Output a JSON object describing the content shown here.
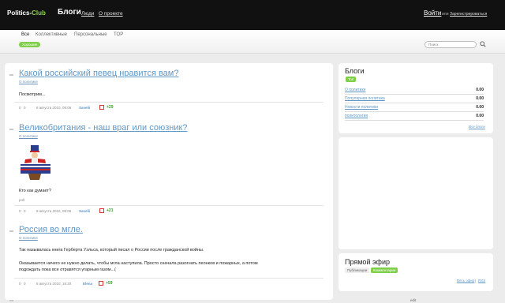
{
  "header": {
    "logo_main": "Politics-",
    "logo_accent": "Club",
    "section_title": "Блоги",
    "nav": [
      "Люди",
      "О проекте"
    ],
    "login": "Войти",
    "or": "или",
    "register": "Зарегистрироваться"
  },
  "subnav": {
    "tabs": [
      "Все",
      "Коллективные",
      "Персональные",
      "TOP"
    ],
    "active_pill": "Хорошие",
    "search_placeholder": "Поиск"
  },
  "posts": [
    {
      "title": "Какой российский певец нравится вам?",
      "category": "О политике",
      "body": "Посмотрим...",
      "votes": "0",
      "comments": "0",
      "date": "8 августа 2010, 09:06",
      "author": "Savelii",
      "score": "+29"
    },
    {
      "title": "Великобритания - наш враг или союзник?",
      "category": "О политике",
      "body": "Кто как думает?",
      "extra": "poll",
      "votes": "0",
      "comments": "0",
      "date": "8 августа 2010, 09:05",
      "author": "Savelii",
      "score": "+21"
    },
    {
      "title": "Россия во мгле.",
      "category": "О политике",
      "body1": "Так называлась книга Герберта Уэльса, который писал о России после гражданской войны.",
      "body2": "Оказывается ничего не нужно делать, чтобы мгла наступила. Просто сначала разогнать пеонков и пожарных, а потом",
      "body3": "подождать пока все отравятся угарным газом...(",
      "votes": "0",
      "comments": "0",
      "date": "6 августа 2010, 16:20",
      "author": "Elena",
      "score": "+59"
    }
  ],
  "sidebar": {
    "blogs_title": "Блоги",
    "blogs_pill": "Топ",
    "blogs": [
      {
        "name": "О политике",
        "value": "0.00"
      },
      {
        "name": "Популярная политика",
        "value": "0.00"
      },
      {
        "name": "Новости политики",
        "value": "0.00"
      },
      {
        "name": "политология",
        "value": "0.00"
      }
    ],
    "all_blogs": "Все блоги",
    "live_title": "Прямой эфир",
    "live_tabs": [
      "Публикации",
      "Комментарии"
    ],
    "all_live": "Весь эфир",
    "rss": "RSS",
    "footer_stub": "edit"
  },
  "colors": {
    "header_bg": "#111111",
    "accent_green": "#7fcf4a",
    "link_blue": "#5e97c6"
  }
}
